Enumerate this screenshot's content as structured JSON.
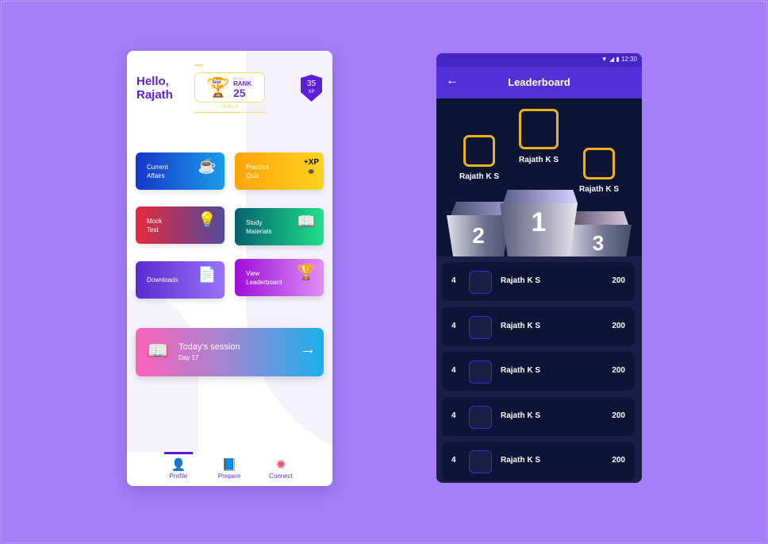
{
  "home": {
    "greeting": "Hello,\nRajath",
    "rank": {
      "trophy_text": "Sept",
      "monthly": "Monthly",
      "label": "RANK",
      "value": "25",
      "level": "LEVEL 0"
    },
    "xp": {
      "value": "35",
      "unit": "XP"
    },
    "tiles": [
      {
        "label": "Current\nAffairs",
        "icon": "coffee-newspaper-icon"
      },
      {
        "label": "Practice\nQuiz",
        "icon": "glasses-xp-icon",
        "badge": "+XP"
      },
      {
        "label": "Mock\nTest",
        "icon": "desk-lamp-icon"
      },
      {
        "label": "Study\nMaterials",
        "icon": "open-book-icon"
      },
      {
        "label": "Downloads",
        "icon": "pinned-document-icon"
      },
      {
        "label": "View\nLeaderboard",
        "icon": "trophy-icon"
      }
    ],
    "session": {
      "title": "Today’s session",
      "subtitle": "Day 17"
    },
    "nav": [
      {
        "label": "Profile"
      },
      {
        "label": "Prepare"
      },
      {
        "label": "Connect"
      }
    ]
  },
  "leaderboard": {
    "status_time": "12:30",
    "title": "Leaderboard",
    "podium": [
      {
        "place": "1",
        "name": "Rajath K S"
      },
      {
        "place": "2",
        "name": "Rajath K S"
      },
      {
        "place": "3",
        "name": "Rajath K S"
      }
    ],
    "rows": [
      {
        "rank": "4",
        "name": "Rajath K S",
        "score": "200"
      },
      {
        "rank": "4",
        "name": "Rajath K S",
        "score": "200"
      },
      {
        "rank": "4",
        "name": "Rajath K S",
        "score": "200"
      },
      {
        "rank": "4",
        "name": "Rajath K S",
        "score": "200"
      },
      {
        "rank": "4",
        "name": "Rajath K S",
        "score": "200"
      }
    ]
  }
}
